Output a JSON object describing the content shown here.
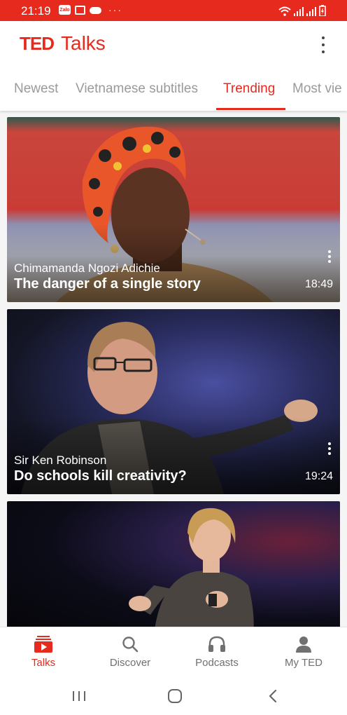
{
  "status_bar": {
    "time": "21:19",
    "left_icons": [
      "zalo-icon",
      "image-icon",
      "cloud-icon",
      "more-dots-icon"
    ],
    "zalo_text": "Zalo",
    "more_text": "···",
    "right_icons": [
      "wifi-icon",
      "signal-icon",
      "signal-icon",
      "battery-icon"
    ]
  },
  "app_bar": {
    "logo_ted": "TED",
    "logo_talks": "Talks",
    "menu_icon": "more-vertical-icon"
  },
  "tabs": {
    "items": [
      {
        "label": "Newest"
      },
      {
        "label": "Vietnamese subtitles"
      },
      {
        "label": "Trending"
      },
      {
        "label": "Most vie"
      }
    ],
    "active": "Trending"
  },
  "talks": [
    {
      "speaker": "Chimamanda Ngozi Adichie",
      "title": "The danger of a single story",
      "duration": "18:49"
    },
    {
      "speaker": "Sir Ken Robinson",
      "title": "Do schools kill creativity?",
      "duration": "19:24"
    },
    {
      "speaker": "",
      "title": "",
      "duration": ""
    }
  ],
  "bottom_nav": {
    "items": [
      {
        "label": "Talks",
        "icon": "play-stack-icon",
        "active": true
      },
      {
        "label": "Discover",
        "icon": "search-icon",
        "active": false
      },
      {
        "label": "Podcasts",
        "icon": "headphones-icon",
        "active": false
      },
      {
        "label": "My TED",
        "icon": "person-icon",
        "active": false
      }
    ]
  },
  "colors": {
    "accent": "#e62b1e",
    "inactive_text": "#9a9a9a",
    "nav_inactive": "#707070"
  }
}
